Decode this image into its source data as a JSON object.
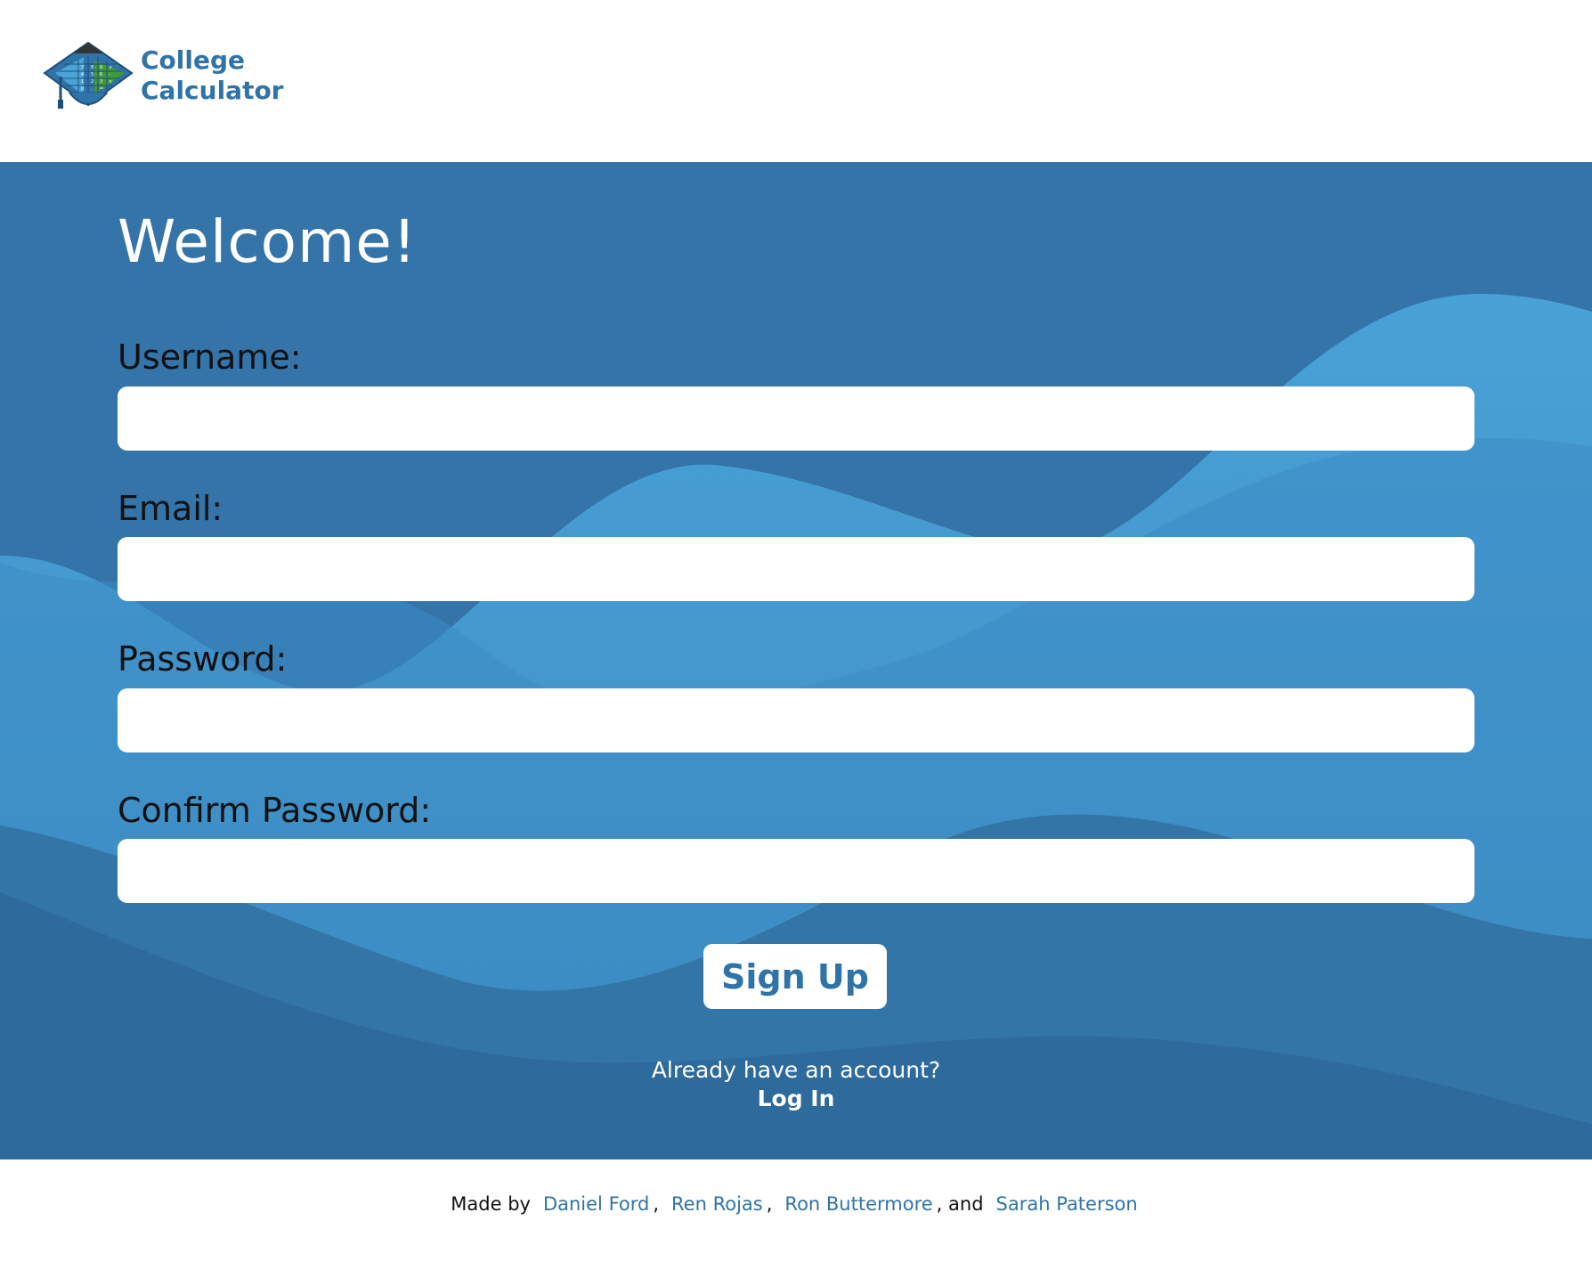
{
  "brand": {
    "name_line1": "College",
    "name_line2": "Calculator",
    "logo_icon": "graduation-cap-calculator-icon"
  },
  "form": {
    "heading": "Welcome!",
    "fields": [
      {
        "label": "Username:",
        "value": "",
        "type": "text"
      },
      {
        "label": "Email:",
        "value": "",
        "type": "email"
      },
      {
        "label": "Password:",
        "value": "",
        "type": "password"
      },
      {
        "label": "Confirm Password:",
        "value": "",
        "type": "password"
      }
    ],
    "submit_label": "Sign Up",
    "already_text": "Already have an account?",
    "login_label": "Log In"
  },
  "footer": {
    "made_by": "Made by",
    "authors": [
      "Daniel Ford",
      "Ren Rojas",
      "Ron Buttermore",
      "Sarah Paterson"
    ],
    "sep_comma": ",",
    "sep_and": ", and"
  },
  "colors": {
    "brand_blue": "#2f73a8",
    "hero_bg": "#3474a8",
    "wave_light": "#4aa4d8",
    "white": "#ffffff"
  }
}
